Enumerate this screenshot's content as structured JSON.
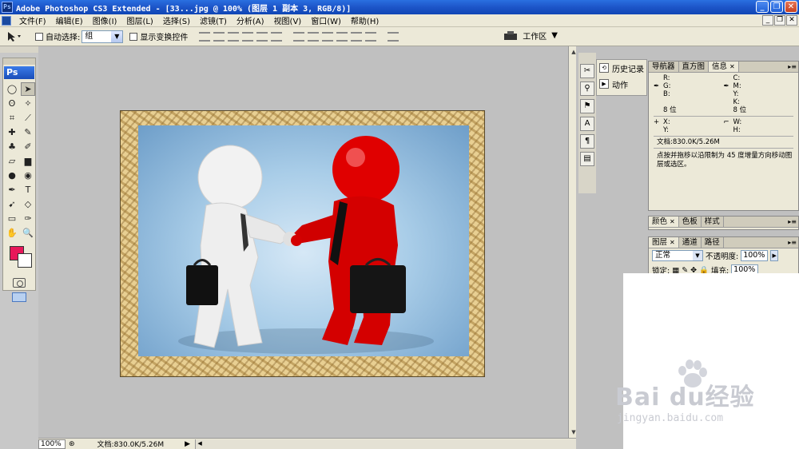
{
  "window": {
    "title": "Adobe Photoshop CS3 Extended - [33...jpg @ 100% (图层 1 副本 3, RGB/8)]",
    "app_icon": "Ps",
    "min": "_",
    "max": "❐",
    "close": "✕"
  },
  "menu": [
    "文件(F)",
    "编辑(E)",
    "图像(I)",
    "图层(L)",
    "选择(S)",
    "滤镜(T)",
    "分析(A)",
    "视图(V)",
    "窗口(W)",
    "帮助(H)"
  ],
  "options": {
    "auto_select_label": "自动选择:",
    "auto_select_value": "组",
    "show_transform_label": "显示变换控件",
    "workspace_label": "工作区"
  },
  "toolbox": {
    "badge": "Ps",
    "tools": [
      "marquee-icon",
      "move-icon",
      "lasso-icon",
      "magic-wand-icon",
      "crop-icon",
      "slice-icon",
      "healing-icon",
      "brush-icon",
      "stamp-icon",
      "history-brush-icon",
      "eraser-icon",
      "gradient-icon",
      "dodge-icon",
      "blur-icon",
      "pen-icon",
      "type-icon",
      "path-select-icon",
      "shape-icon",
      "notes-icon",
      "eyedropper-icon",
      "hand-icon",
      "zoom-icon"
    ],
    "glyphs": [
      "◯",
      "➤",
      "ʘ",
      "✧",
      "⌗",
      "⟋",
      "✚",
      "✎",
      "♣",
      "✐",
      "▱",
      "▆",
      "●",
      "◉",
      "✒",
      "T",
      "➹",
      "◇",
      "▭",
      "✑",
      "✋",
      "🔍"
    ],
    "fg_color": "#e8175a",
    "bg_color": "#ffffff"
  },
  "dock": {
    "history_label": "历史记录",
    "actions_label": "动作"
  },
  "info_panel": {
    "tabs": [
      "导航器",
      "直方图",
      "信息"
    ],
    "left_lines": [
      "R:",
      "G:",
      "B:"
    ],
    "right_lines": [
      "C:",
      "M:",
      "Y:",
      "K:"
    ],
    "bit_left": "8 位",
    "bit_right": "8 位",
    "xy_lines": [
      "X:",
      "Y:"
    ],
    "wh_lines": [
      "W:",
      "H:"
    ],
    "doc": "文档:830.0K/5.26M",
    "hint": "点按并拖移以沿限制为 45 度增量方向移动图层或选区。"
  },
  "color_panel": {
    "tabs": [
      "颜色",
      "色板",
      "样式"
    ]
  },
  "layers_panel": {
    "tabs": [
      "图层",
      "通道",
      "路径"
    ],
    "mode": "正常",
    "opacity_label": "不透明度:",
    "opacity_value": "100%",
    "lock_label": "锁定:",
    "fill_label": "填充:",
    "fill_value": "100%"
  },
  "status": {
    "zoom": "100%",
    "doc": "文档:830.0K/5.26M"
  },
  "watermark": {
    "logo": "Bai  du经验",
    "url": "jingyan.baidu.com"
  },
  "colors": {
    "titlebar": "#1d55c8",
    "chrome": "#ece9d8",
    "canvas_bg": "#c0c0c0"
  }
}
